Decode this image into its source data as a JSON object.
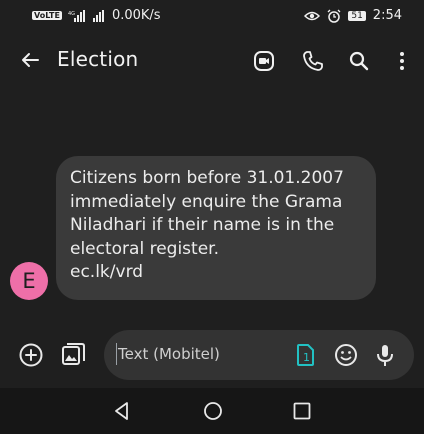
{
  "status_bar": {
    "network_speed": "0.00K/s",
    "network_label": "4G",
    "volte_label": "VoLTE",
    "battery_level": "51",
    "time": "2:54"
  },
  "app_bar": {
    "title": "Election",
    "icons": [
      "back-arrow-icon",
      "video-call-icon",
      "phone-icon",
      "search-icon",
      "more-vert-icon"
    ]
  },
  "message": {
    "sender_initial": "E",
    "avatar_color": "#ee6fa8",
    "lines": [
      "Citizens born before 31.01.2007",
      "immediately enquire the Grama",
      "Niladhari if their name is in the",
      "electoral register.",
      "ec.lk/vrd"
    ]
  },
  "compose": {
    "placeholder": "Text (Mobitel)",
    "sim_slot": "1",
    "sim_color": "#22c1c3"
  },
  "nav_bar": {
    "icons": [
      "back-triangle-icon",
      "home-circle-icon",
      "recents-square-icon"
    ]
  }
}
